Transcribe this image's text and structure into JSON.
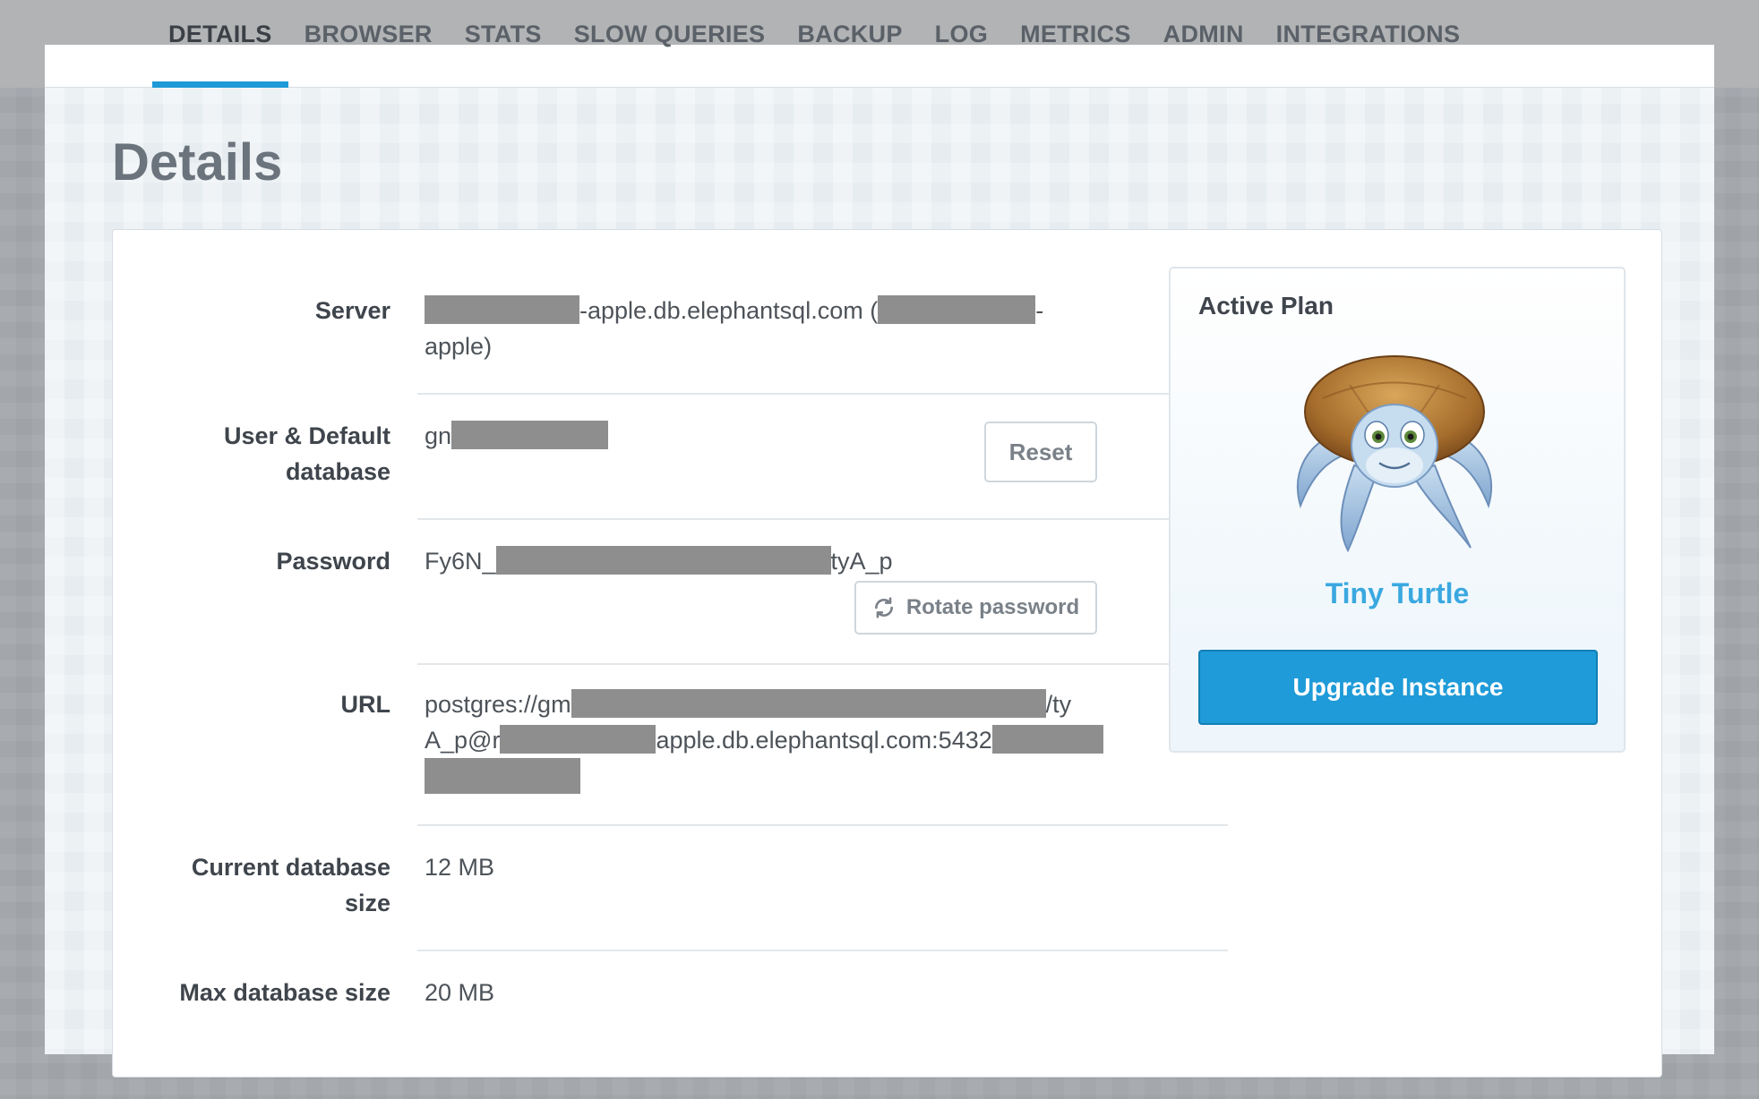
{
  "tabs": [
    "DETAILS",
    "BROWSER",
    "STATS",
    "SLOW QUERIES",
    "BACKUP",
    "LOG",
    "METRICS",
    "ADMIN",
    "INTEGRATIONS"
  ],
  "active_tab": "DETAILS",
  "page_title": "Details",
  "details": {
    "server": {
      "label": "Server",
      "part1": "-apple.db.elephantsql.com (",
      "part2": "-",
      "part3": "apple)"
    },
    "user": {
      "label_line1": "User & Default",
      "label_line2": "database",
      "prefix": "gn",
      "reset_label": "Reset"
    },
    "password": {
      "label": "Password",
      "prefix": "Fy6N_",
      "suffix": "tyA_p",
      "rotate_label": "Rotate password"
    },
    "url": {
      "label": "URL",
      "line1_prefix": "postgres://gm",
      "line1_suffix": "/ty",
      "line2_prefix": "A_p@r",
      "line2_suffix": "apple.db.elephantsql.com:5432"
    },
    "current_size": {
      "label_line1": "Current database",
      "label_line2": "size",
      "value": "12 MB"
    },
    "max_size": {
      "label": "Max database size",
      "value": "20 MB"
    }
  },
  "plan": {
    "title": "Active Plan",
    "name": "Tiny Turtle",
    "upgrade_label": "Upgrade Instance"
  },
  "colors": {
    "accent": "#1e9bd8",
    "plan_name": "#3aa8e0"
  }
}
